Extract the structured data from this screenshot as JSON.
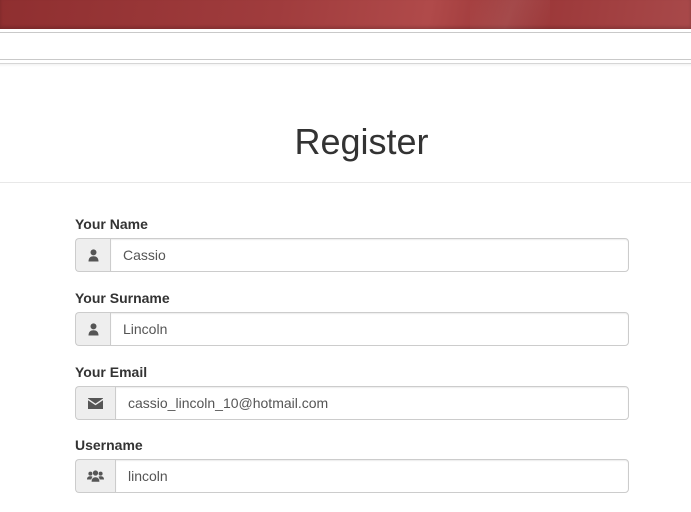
{
  "page": {
    "title": "Register"
  },
  "form": {
    "fields": [
      {
        "label": "Your Name",
        "value": "Cassio",
        "icon": "user-icon"
      },
      {
        "label": "Your Surname",
        "value": "Lincoln",
        "icon": "user-icon"
      },
      {
        "label": "Your Email",
        "value": "cassio_lincoln_10@hotmail.com",
        "icon": "envelope-icon"
      },
      {
        "label": "Username",
        "value": "lincoln",
        "icon": "users-icon"
      }
    ]
  },
  "colors": {
    "header_bar": "#a03c3d",
    "addon_bg": "#eeeeee",
    "icon": "#555555",
    "border": "#cccccc"
  }
}
